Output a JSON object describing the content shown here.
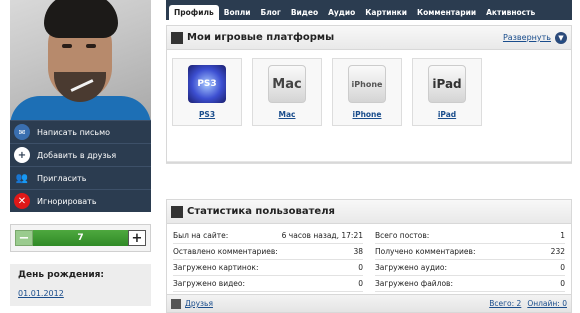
{
  "profile": {
    "actions": [
      {
        "label": "Написать письмо",
        "icon": "mail-icon"
      },
      {
        "label": "Добавить в друзья",
        "icon": "plus-icon"
      },
      {
        "label": "Пригласить",
        "icon": "invite-icon"
      },
      {
        "label": "Игнорировать",
        "icon": "block-icon"
      }
    ],
    "rating": {
      "value": "7",
      "minus": "−",
      "plus": "+"
    },
    "birthday": {
      "heading": "День рождения:",
      "date": "01.01.2012"
    }
  },
  "tabs": [
    "Профиль",
    "Вопли",
    "Блог",
    "Видео",
    "Аудио",
    "Картинки",
    "Комментарии",
    "Активность"
  ],
  "platforms_panel": {
    "title": "Мои игровые платформы",
    "expand": "Развернуть",
    "items": [
      {
        "logo": "PS3",
        "label": "PS3"
      },
      {
        "logo": "Mac",
        "label": "Mac"
      },
      {
        "logo": "iPhone",
        "label": "iPhone"
      },
      {
        "logo": "iPad",
        "label": "iPad"
      }
    ]
  },
  "stats_panel": {
    "title": "Статистика пользователя",
    "left": [
      {
        "label": "Был на сайте:",
        "value": "6 часов назад, 17:21"
      },
      {
        "label": "Оставлено комментариев:",
        "value": "38"
      },
      {
        "label": "Загружено картинок:",
        "value": "0"
      },
      {
        "label": "Загружено видео:",
        "value": "0"
      }
    ],
    "right": [
      {
        "label": "Всего постов:",
        "value": "1"
      },
      {
        "label": "Получено комментариев:",
        "value": "232"
      },
      {
        "label": "Загружено аудио:",
        "value": "0"
      },
      {
        "label": "Загружено файлов:",
        "value": "0"
      }
    ],
    "footer": {
      "friends": "Друзья",
      "total": "Всего: 2",
      "online": "Онлайн: 0"
    }
  },
  "colors": {
    "nav_bg": "#2b3c50",
    "link": "#1a4d8c",
    "rating_green": "#2f8a26",
    "ignore_red": "#e01818"
  }
}
